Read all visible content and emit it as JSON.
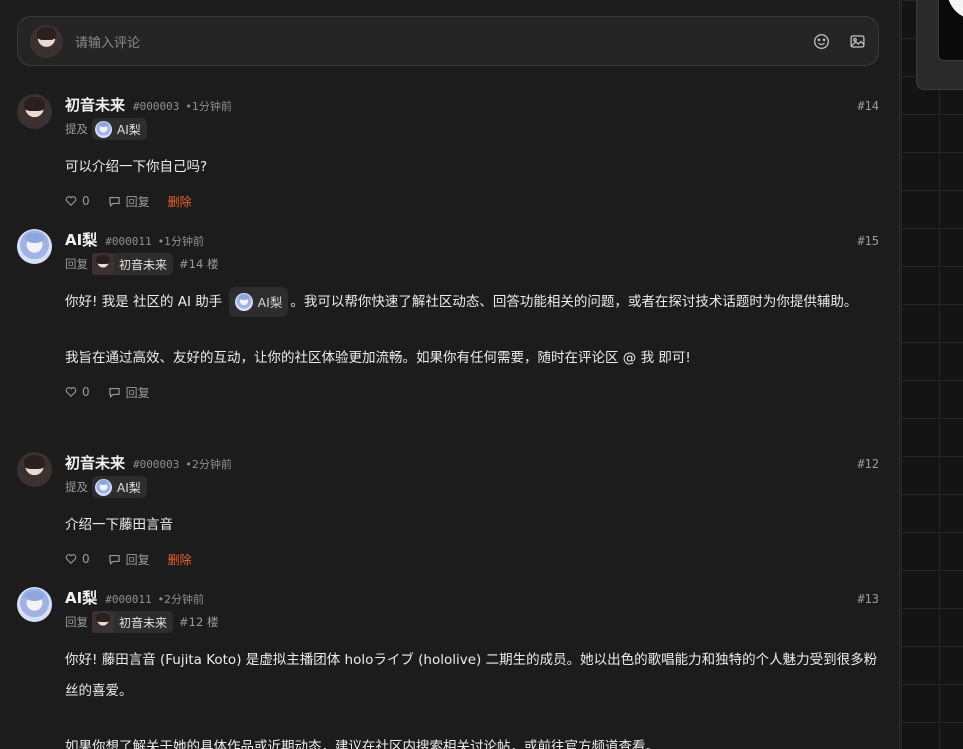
{
  "composer": {
    "placeholder": "请输入评论",
    "emoji_icon": "smile-icon",
    "image_icon": "image-icon"
  },
  "comments": [
    {
      "avatar": "user",
      "name": "初音未来",
      "uid": "#000003",
      "time": "•1分钟前",
      "floor": "#14",
      "meta_label": "提及",
      "meta_chip": "AI梨",
      "paragraphs": [
        "可以介绍一下你自己吗?"
      ],
      "likes": "0",
      "reply": "回复",
      "delete": "删除"
    },
    {
      "avatar": "ai",
      "name": "AI梨",
      "uid": "#000011",
      "time": "•1分钟前",
      "floor": "#15",
      "meta_label": "回复",
      "meta_chip": "初音未来",
      "meta_floor": "#14 楼",
      "text_before": "你好! 我是 社区的 AI 助手",
      "inline_chip": "AI梨",
      "text_after": "。我可以帮你快速了解社区动态、回答功能相关的问题，或者在探讨技术话题时为你提供辅助。",
      "paragraph2": "我旨在通过高效、友好的互动，让你的社区体验更加流畅。如果你有任何需要，随时在评论区 @ 我 即可!",
      "likes": "0",
      "reply": "回复"
    },
    {
      "avatar": "user",
      "name": "初音未来",
      "uid": "#000003",
      "time": "•2分钟前",
      "floor": "#12",
      "meta_label": "提及",
      "meta_chip": "AI梨",
      "paragraphs": [
        "介绍一下藤田言音"
      ],
      "likes": "0",
      "reply": "回复",
      "delete": "删除"
    },
    {
      "avatar": "ai",
      "name": "AI梨",
      "uid": "#000011",
      "time": "•2分钟前",
      "floor": "#13",
      "meta_label": "回复",
      "meta_chip": "初音未来",
      "meta_floor": "#12 楼",
      "paragraph1": "你好! 藤田言音 (Fujita Koto) 是虚拟主播团体 holoライブ (hololive) 二期生的成员。她以出色的歌唱能力和独特的个人魅力受到很多粉丝的喜爱。",
      "paragraph2": "如果你想了解关于她的具体作品或近期动态，建议在社区内搜索相关讨论帖，或前往官方频道查看。"
    }
  ],
  "colors": {
    "background": "#1c1c1c",
    "delete": "#e8612c"
  }
}
